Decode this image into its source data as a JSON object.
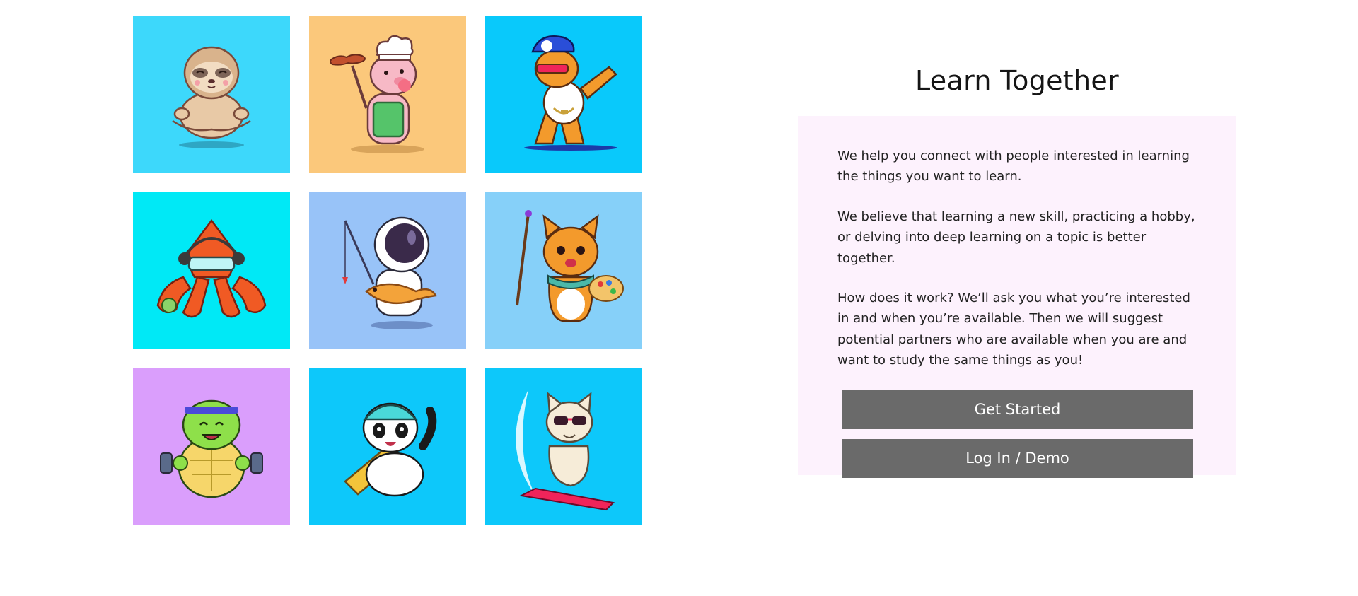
{
  "tiles": [
    {
      "name": "sloth-tile",
      "icon": "meditating-sloth-icon",
      "bg": "#3dd8fb"
    },
    {
      "name": "pig-chef-tile",
      "icon": "pig-chef-grilling-icon",
      "bg": "#fbc87b"
    },
    {
      "name": "dabbing-dog-tile",
      "icon": "dabbing-dog-icon",
      "bg": "#09c9fb"
    },
    {
      "name": "octopus-scientist-tile",
      "icon": "octopus-scientist-icon",
      "bg": "#00e9f6"
    },
    {
      "name": "astronaut-fishing-tile",
      "icon": "astronaut-fishing-icon",
      "bg": "#98c3f8"
    },
    {
      "name": "cat-painter-tile",
      "icon": "cat-painter-icon",
      "bg": "#86d0f9"
    },
    {
      "name": "turtle-lifting-tile",
      "icon": "turtle-weightlifting-icon",
      "bg": "#da9efc"
    },
    {
      "name": "panda-skateboard-tile",
      "icon": "panda-skateboarding-icon",
      "bg": "#0dc8fa"
    },
    {
      "name": "cat-surfing-tile",
      "icon": "cat-surfing-icon",
      "bg": "#0dc8fa"
    }
  ],
  "hero": {
    "title": "Learn Together",
    "paragraphs": [
      "We help you connect with people interested in learning the things you want to learn.",
      "We believe that learning a new skill, practicing a hobby, or delving into deep learning on a topic is better together.",
      "How does it work? We’ll ask you what you’re interested in and when you’re available. Then we will suggest potential partners who are available when you are and want to study the same things as you!"
    ],
    "get_started_label": "Get Started",
    "login_label": "Log In / Demo"
  },
  "colors": {
    "card_bg": "#fdf2fd",
    "button_bg": "#6a6a6a",
    "button_text": "#ffffff"
  }
}
